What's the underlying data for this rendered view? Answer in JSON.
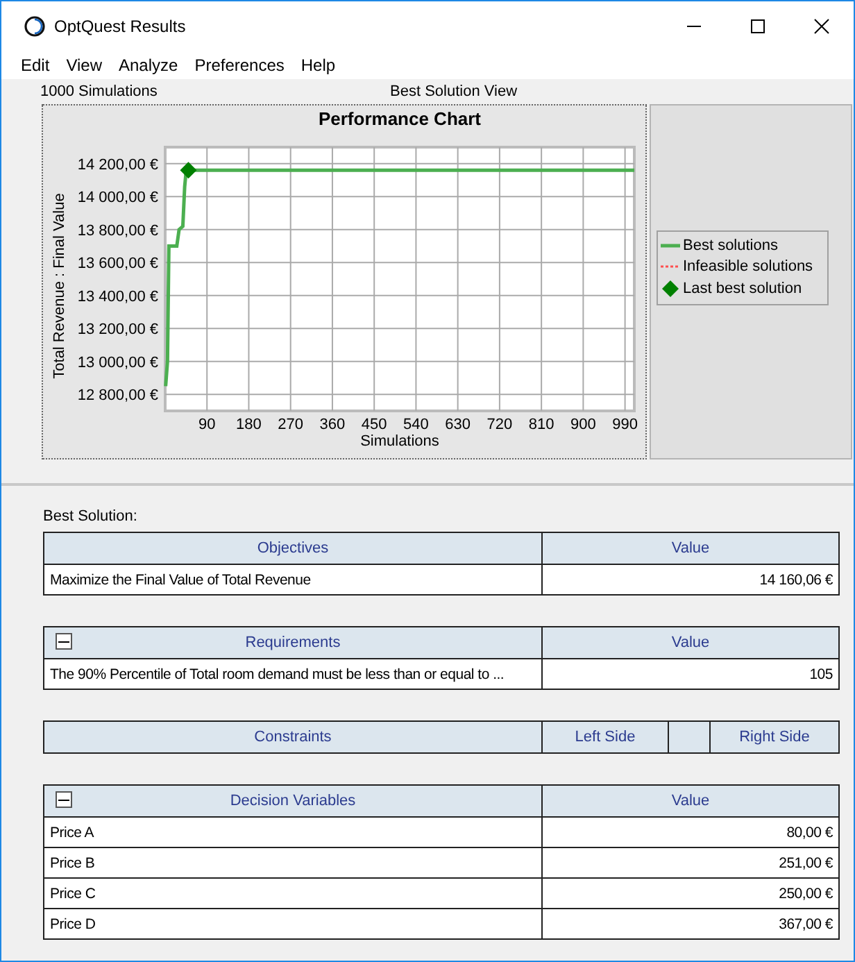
{
  "window": {
    "title": "OptQuest Results"
  },
  "menu": [
    "Edit",
    "View",
    "Analyze",
    "Preferences",
    "Help"
  ],
  "header": {
    "left": "1000 Simulations",
    "center": "Best Solution View"
  },
  "chart": {
    "chart_data": {
      "type": "line",
      "title": "Performance Chart",
      "xlabel": "Simulations",
      "ylabel": "Total Revenue : Final Value",
      "xlim": [
        0,
        1010
      ],
      "ylim": [
        12700,
        14300
      ],
      "xticks": [
        90,
        180,
        270,
        360,
        450,
        540,
        630,
        720,
        810,
        900,
        990
      ],
      "yticks": [
        {
          "value": 12800,
          "label": "12 800,00 €"
        },
        {
          "value": 13000,
          "label": "13 000,00 €"
        },
        {
          "value": 13200,
          "label": "13 200,00 €"
        },
        {
          "value": 13400,
          "label": "13 400,00 €"
        },
        {
          "value": 13600,
          "label": "13 600,00 €"
        },
        {
          "value": 13800,
          "label": "13 800,00 €"
        },
        {
          "value": 14000,
          "label": "14 000,00 €"
        },
        {
          "value": 14200,
          "label": "14 200,00 €"
        }
      ],
      "x": [
        1,
        5,
        8,
        25,
        30,
        38,
        42,
        45,
        50,
        60,
        1010
      ],
      "grid": true,
      "series": [
        {
          "name": "Best solutions",
          "color": "#4caf50",
          "values": [
            12850,
            13000,
            13700,
            13700,
            13800,
            13820,
            14060,
            14150,
            14160,
            14160,
            14160
          ]
        }
      ]
    },
    "legend": [
      {
        "label": "Infeasible solutions",
        "kind": "dotted",
        "color": "#ff5050"
      },
      {
        "label": "Last best solution",
        "kind": "diamond",
        "color": "#008000"
      }
    ]
  },
  "best_solution": {
    "label": "Best Solution:",
    "tables": [
      {
        "kind": "plain",
        "columns": [
          "Objectives",
          "Value"
        ],
        "rows": [
          [
            "Maximize the Final Value of Total Revenue",
            "14 160,06 €"
          ]
        ]
      },
      {
        "kind": "plain",
        "expanded": true,
        "columns": [
          "Requirements",
          "Value"
        ],
        "rows": [
          [
            "The 90% Percentile of Total room demand must be less than or equal to ...",
            "105"
          ]
        ]
      },
      {
        "kind": "constraints",
        "columns": [
          "Constraints",
          "Left Side",
          "Right Side"
        ]
      },
      {
        "kind": "plain",
        "expanded": true,
        "columns": [
          "Decision Variables",
          "Value"
        ],
        "rows": [
          [
            "Price A",
            "80,00 €"
          ],
          [
            "Price B",
            "251,00 €"
          ],
          [
            "Price C",
            "250,00 €"
          ],
          [
            "Price D",
            "367,00 €"
          ]
        ]
      }
    ]
  }
}
